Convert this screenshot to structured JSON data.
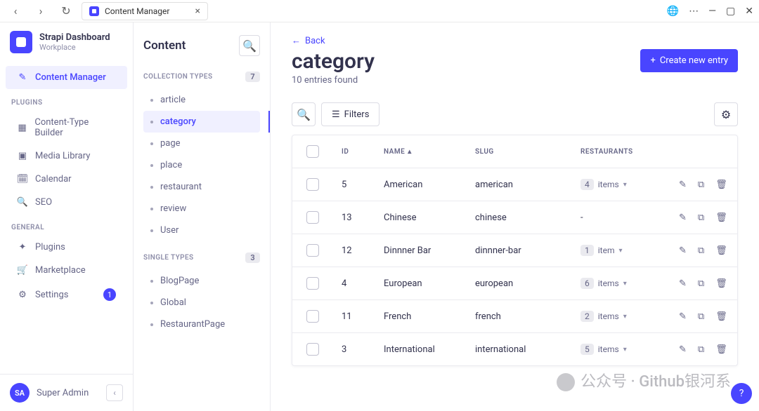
{
  "browser": {
    "tab_title": "Content Manager"
  },
  "brand": {
    "title": "Strapi Dashboard",
    "subtitle": "Workplace"
  },
  "sidebar": {
    "content_manager": "Content Manager",
    "plugins_label": "PLUGINS",
    "plugins": {
      "ctb": "Content-Type Builder",
      "media": "Media Library",
      "calendar": "Calendar",
      "seo": "SEO"
    },
    "general_label": "GENERAL",
    "general": {
      "plugins": "Plugins",
      "marketplace": "Marketplace",
      "settings": "Settings",
      "settings_badge": "1"
    }
  },
  "user": {
    "initials": "SA",
    "name": "Super Admin"
  },
  "content_panel": {
    "title": "Content",
    "collection_label": "COLLECTION TYPES",
    "collection_count": "7",
    "collection_items": [
      "article",
      "category",
      "page",
      "place",
      "restaurant",
      "review",
      "User"
    ],
    "single_label": "SINGLE TYPES",
    "single_count": "3",
    "single_items": [
      "BlogPage",
      "Global",
      "RestaurantPage"
    ]
  },
  "main": {
    "back": "Back",
    "title": "category",
    "subtitle": "10 entries found",
    "create_btn": "Create new entry",
    "filters": "Filters",
    "columns": {
      "id": "ID",
      "name": "NAME",
      "slug": "SLUG",
      "restaurants": "RESTAURANTS"
    },
    "rows": [
      {
        "id": "5",
        "name": "American",
        "slug": "american",
        "count": "4",
        "unit": "items"
      },
      {
        "id": "13",
        "name": "Chinese",
        "slug": "chinese",
        "count": "",
        "unit": "-"
      },
      {
        "id": "12",
        "name": "Dinnner Bar",
        "slug": "dinnner-bar",
        "count": "1",
        "unit": "item"
      },
      {
        "id": "4",
        "name": "European",
        "slug": "european",
        "count": "6",
        "unit": "items"
      },
      {
        "id": "11",
        "name": "French",
        "slug": "french",
        "count": "2",
        "unit": "items"
      },
      {
        "id": "3",
        "name": "International",
        "slug": "international",
        "count": "5",
        "unit": "items"
      }
    ]
  },
  "watermark": "公众号 · Github银河系"
}
